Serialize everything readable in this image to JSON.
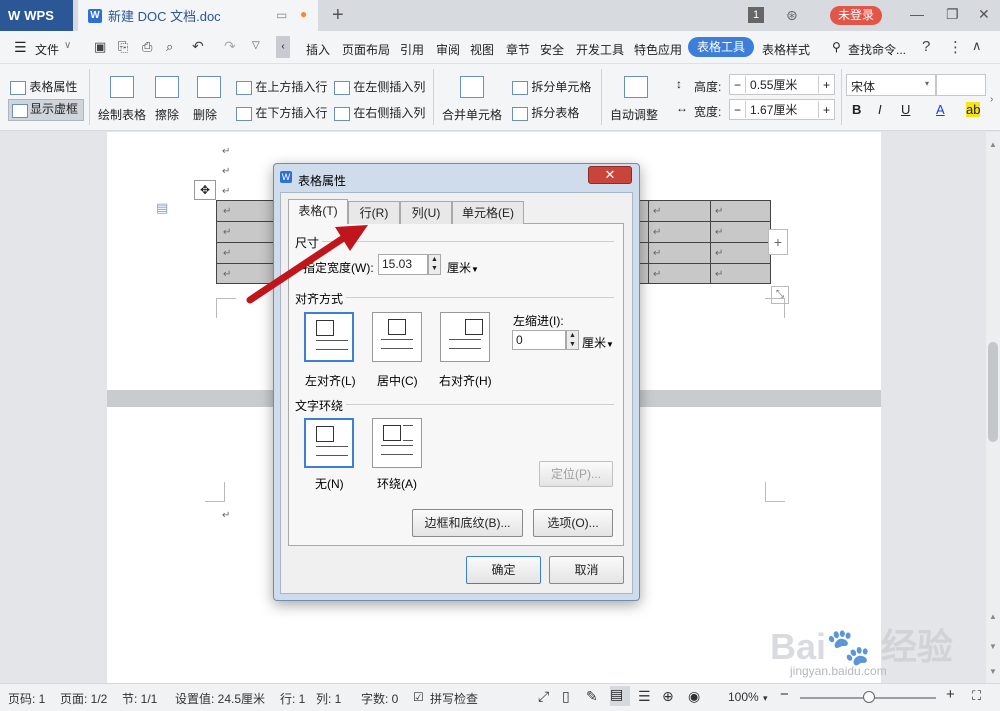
{
  "titlebar": {
    "app_name": "WPS",
    "doc_tab": "新建 DOC 文档.doc",
    "page_badge": "1",
    "login": "未登录"
  },
  "menubar": {
    "file": "文件",
    "items": [
      "插入",
      "页面布局",
      "引用",
      "审阅",
      "视图",
      "章节",
      "安全",
      "开发工具",
      "特色应用"
    ],
    "active": "表格工具",
    "table_style": "表格样式",
    "search": "查找命令..."
  },
  "ribbon": {
    "table_props": "表格属性",
    "show_gridlines": "显示虚框",
    "draw_table": "绘制表格",
    "erase": "擦除",
    "delete": "删除",
    "insert_above": "在上方插入行",
    "insert_below": "在下方插入行",
    "insert_left": "在左侧插入列",
    "insert_right": "在右侧插入列",
    "merge_cells": "合并单元格",
    "split_cells": "拆分单元格",
    "split_table": "拆分表格",
    "auto_adjust": "自动调整",
    "height_label": "高度:",
    "height_value": "0.55厘米",
    "width_label": "宽度:",
    "width_value": "1.67厘米",
    "font_name": "宋体",
    "bold": "B",
    "italic": "I",
    "underline": "U",
    "font_color": "A",
    "highlight": "ab"
  },
  "document": {
    "para_mark": "↵"
  },
  "dialog": {
    "title": "表格属性",
    "close": "✕",
    "tabs": [
      "表格(T)",
      "行(R)",
      "列(U)",
      "单元格(E)"
    ],
    "size_group": "尺寸",
    "width_label": "指定宽度(W):",
    "width_value": "15.03",
    "width_unit": "厘米",
    "align_group": "对齐方式",
    "align_left": "左对齐(L)",
    "align_center": "居中(C)",
    "align_right": "右对齐(H)",
    "indent_label": "左缩进(I):",
    "indent_value": "0",
    "indent_unit": "厘米",
    "wrap_group": "文字环绕",
    "wrap_none": "无(N)",
    "wrap_around": "环绕(A)",
    "position_button": "定位(P)...",
    "borders_button": "边框和底纹(B)...",
    "options_button": "选项(O)...",
    "ok": "确定",
    "cancel": "取消"
  },
  "statusbar": {
    "page_num": "页码: 1",
    "pages": "页面: 1/2",
    "section": "节: 1/1",
    "setting": "设置值: 24.5厘米",
    "row": "行: 1",
    "col": "列: 1",
    "words": "字数: 0",
    "spell_check": "拼写检查",
    "zoom": "100%"
  },
  "zoom_level": 100,
  "colors": {
    "accent": "#3c7ed9",
    "wps_blue": "#2b5797",
    "login_red": "#e2564a",
    "arrow_red": "#c0151b"
  }
}
